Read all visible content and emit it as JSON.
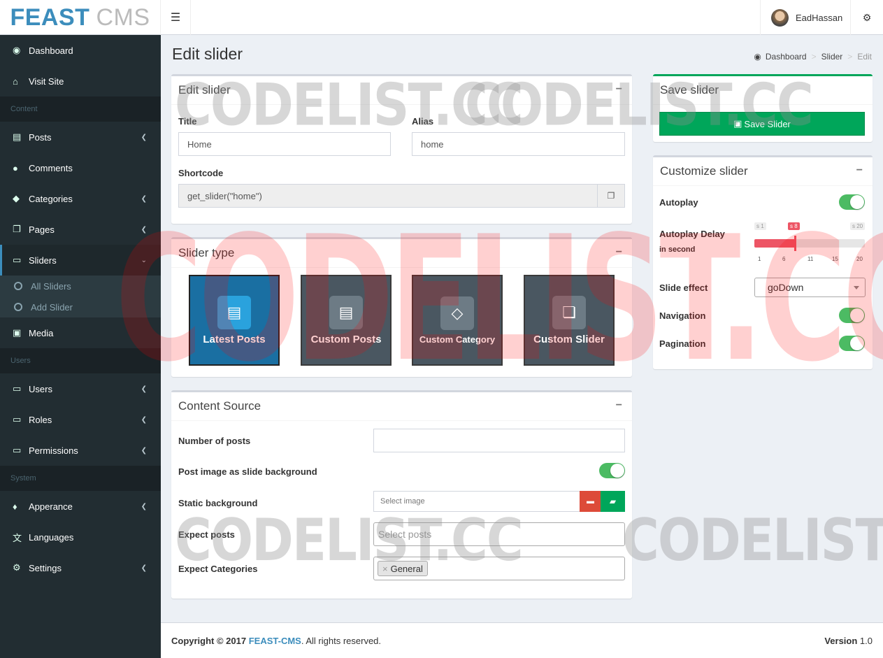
{
  "header": {
    "brand_bold": "FEAST",
    "brand_light": "CMS",
    "menu_icon": "bars",
    "username": "EadHassan",
    "settings_icon": "gears"
  },
  "sidebar": {
    "items": [
      {
        "label": "Dashboard",
        "icon": "dashboard"
      },
      {
        "label": "Visit Site",
        "icon": "home"
      },
      {
        "label": "Posts",
        "icon": "file"
      },
      {
        "label": "Comments",
        "icon": "comment"
      },
      {
        "label": "Categories",
        "icon": "tags"
      },
      {
        "label": "Pages",
        "icon": "copy"
      },
      {
        "label": "Sliders",
        "icon": "desktop"
      },
      {
        "label": "Media",
        "icon": "image"
      },
      {
        "label": "Users",
        "icon": "desktop"
      },
      {
        "label": "Roles",
        "icon": "desktop"
      },
      {
        "label": "Permissions",
        "icon": "desktop"
      },
      {
        "label": "Apperance",
        "icon": "tint"
      },
      {
        "label": "Languages",
        "icon": "language"
      },
      {
        "label": "Settings",
        "icon": "gears"
      }
    ],
    "headers": [
      "Content",
      "Users",
      "System"
    ],
    "subitems": [
      "All Sliders",
      "Add Slider"
    ]
  },
  "page": {
    "title": "Edit slider",
    "breadcrumb": [
      "Dashboard",
      "Slider",
      "Edit"
    ]
  },
  "edit_box": {
    "title": "Edit slider",
    "title_label": "Title",
    "title_value": "Home",
    "alias_label": "Alias",
    "alias_value": "home",
    "shortcode_label": "Shortcode",
    "shortcode_value": "get_slider(\"home\")"
  },
  "slider_type": {
    "title": "Slider type",
    "tiles": [
      "Latest Posts",
      "Custom Posts",
      "Custom Category",
      "Custom Slider"
    ],
    "selected": "Latest Posts"
  },
  "content_source": {
    "title": "Content Source",
    "number_label": "Number of posts",
    "number_value": "",
    "post_image_label": "Post image as slide background",
    "post_image_on": true,
    "static_bg_label": "Static background",
    "static_bg_placeholder": "Select image",
    "expect_posts_label": "Expect posts",
    "expect_posts_placeholder": "Select posts",
    "expect_categories_label": "Expect Categories",
    "expect_categories_chip": "General"
  },
  "save_box": {
    "title": "Save slider",
    "button": "Save Slider"
  },
  "customize": {
    "title": "Customize slider",
    "autoplay_label": "Autoplay",
    "autoplay_on": true,
    "delay_label": "Autoplay Delay",
    "delay_sub": "in second",
    "delay_min_tag": "s 1",
    "delay_value_tag": "s 8",
    "delay_max_tag": "s 20",
    "delay_value": 8,
    "delay_min": 1,
    "delay_max": 20,
    "ticks": [
      "1",
      "6",
      "11",
      "15",
      "20"
    ],
    "effect_label": "Slide effect",
    "effect_value": "goDown",
    "navigation_label": "Navigation",
    "navigation_on": true,
    "pagination_label": "Pagination",
    "pagination_on": true
  },
  "footer": {
    "copyright": "Copyright © 2017",
    "brand": "FEAST-CMS",
    "rights": ". All rights reserved.",
    "version_label": "Version",
    "version_value": "1.0"
  },
  "watermark": "CODELIST.CC",
  "colors": {
    "accent": "#3c8dbc",
    "success": "#00a65a",
    "sidebar": "#222d32",
    "slider": "#ed5565",
    "toggle": "#4cbb63"
  }
}
